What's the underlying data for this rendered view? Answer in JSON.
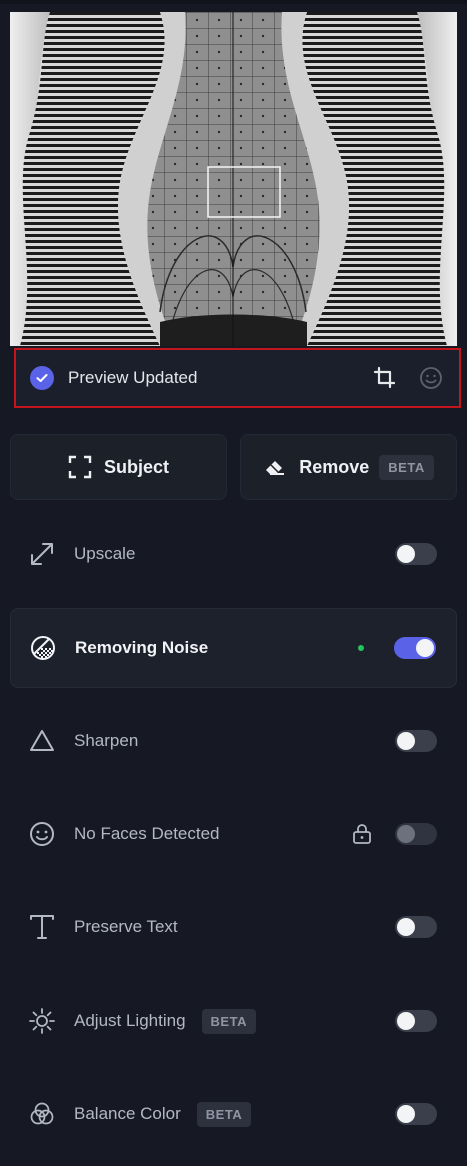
{
  "status": {
    "text": "Preview Updated"
  },
  "actions": {
    "subject_label": "Subject",
    "remove_label": "Remove",
    "remove_badge": "BETA"
  },
  "features": [
    {
      "label": "Upscale",
      "icon": "upscale-icon",
      "state": "off"
    },
    {
      "label": "Removing Noise",
      "icon": "noise-icon",
      "state": "on",
      "active": true
    },
    {
      "label": "Sharpen",
      "icon": "sharpen-icon",
      "state": "off"
    },
    {
      "label": "No Faces Detected",
      "icon": "face-icon",
      "state": "disabled",
      "locked": true
    },
    {
      "label": "Preserve Text",
      "icon": "text-icon",
      "state": "off"
    },
    {
      "label": "Adjust Lighting",
      "icon": "sun-icon",
      "state": "off",
      "badge": "BETA"
    },
    {
      "label": "Balance Color",
      "icon": "color-balance-icon",
      "state": "off",
      "badge": "BETA"
    }
  ],
  "colors": {
    "accent": "#5a63e8",
    "highlight_border": "#c4151c",
    "active_dot": "#22c55e",
    "background": "#161923"
  }
}
